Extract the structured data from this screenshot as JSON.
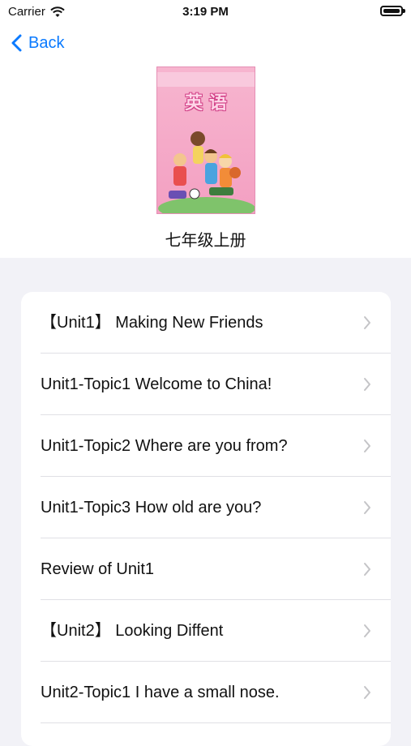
{
  "status_bar": {
    "carrier": "Carrier",
    "time": "3:19 PM",
    "battery_level": 1.0
  },
  "nav": {
    "back_label": "Back",
    "accent": "#0a7aff"
  },
  "book": {
    "cover_title": "英 语",
    "title": "七年级上册"
  },
  "lessons": [
    {
      "label": "【Unit1】 Making New Friends"
    },
    {
      "label": "Unit1-Topic1 Welcome to China!"
    },
    {
      "label": "Unit1-Topic2 Where are you from?"
    },
    {
      "label": "Unit1-Topic3 How old are you?"
    },
    {
      "label": "Review of Unit1"
    },
    {
      "label": "【Unit2】 Looking Diffent"
    },
    {
      "label": "Unit2-Topic1 I have a small nose."
    }
  ]
}
